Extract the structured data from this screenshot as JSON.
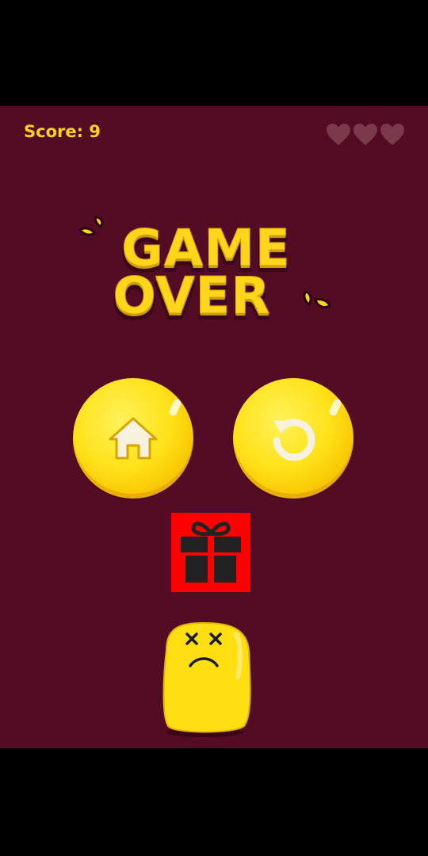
{
  "hud": {
    "score_text": "Score: 9",
    "lives_total": 3,
    "lives_remaining": 0,
    "heart_color": "#7a3a4b"
  },
  "title": {
    "line1": "GAME",
    "line2": "OVER"
  },
  "buttons": {
    "home_icon": "home-icon",
    "replay_icon": "replay-icon",
    "gift_icon": "gift-icon"
  },
  "colors": {
    "background": "#540b24",
    "accent_yellow": "#ffd61c",
    "gift_bg": "#ff0000"
  }
}
